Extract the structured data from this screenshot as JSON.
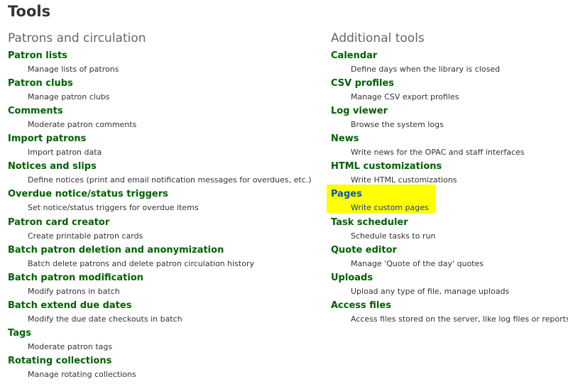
{
  "page": {
    "title": "Tools",
    "highlight_color": "#ffff00",
    "link_color": "#006100"
  },
  "left_column": {
    "heading": "Patrons and circulation",
    "items": [
      {
        "label": "Patron lists",
        "description": "Manage lists of patrons"
      },
      {
        "label": "Patron clubs",
        "description": "Manage patron clubs"
      },
      {
        "label": "Comments",
        "description": "Moderate patron comments"
      },
      {
        "label": "Import patrons",
        "description": "Import patron data"
      },
      {
        "label": "Notices and slips",
        "description": "Define notices (print and email notification messages for overdues, etc.)"
      },
      {
        "label": "Overdue notice/status triggers",
        "description": "Set notice/status triggers for overdue items"
      },
      {
        "label": "Patron card creator",
        "description": "Create printable patron cards"
      },
      {
        "label": "Batch patron deletion and anonymization",
        "description": "Batch delete patrons and delete patron circulation history"
      },
      {
        "label": "Batch patron modification",
        "description": "Modify patrons in batch"
      },
      {
        "label": "Batch extend due dates",
        "description": "Modify the due date checkouts in batch"
      },
      {
        "label": "Tags",
        "description": "Moderate patron tags"
      },
      {
        "label": "Rotating collections",
        "description": "Manage rotating collections"
      }
    ]
  },
  "right_column": {
    "heading": "Additional tools",
    "items": [
      {
        "label": "Calendar",
        "description": "Define days when the library is closed"
      },
      {
        "label": "CSV profiles",
        "description": "Manage CSV export profiles"
      },
      {
        "label": "Log viewer",
        "description": "Browse the system logs"
      },
      {
        "label": "News",
        "description": "Write news for the OPAC and staff interfaces"
      },
      {
        "label": "HTML customizations",
        "description": "Write HTML customizations"
      },
      {
        "label": "Pages",
        "description": "Write custom pages",
        "highlighted": true
      },
      {
        "label": "Task scheduler",
        "description": "Schedule tasks to run"
      },
      {
        "label": "Quote editor",
        "description": "Manage 'Quote of the day' quotes"
      },
      {
        "label": "Uploads",
        "description": "Upload any type of file, manage uploads"
      },
      {
        "label": "Access files",
        "description": "Access files stored on the server, like log files or reports"
      }
    ]
  }
}
